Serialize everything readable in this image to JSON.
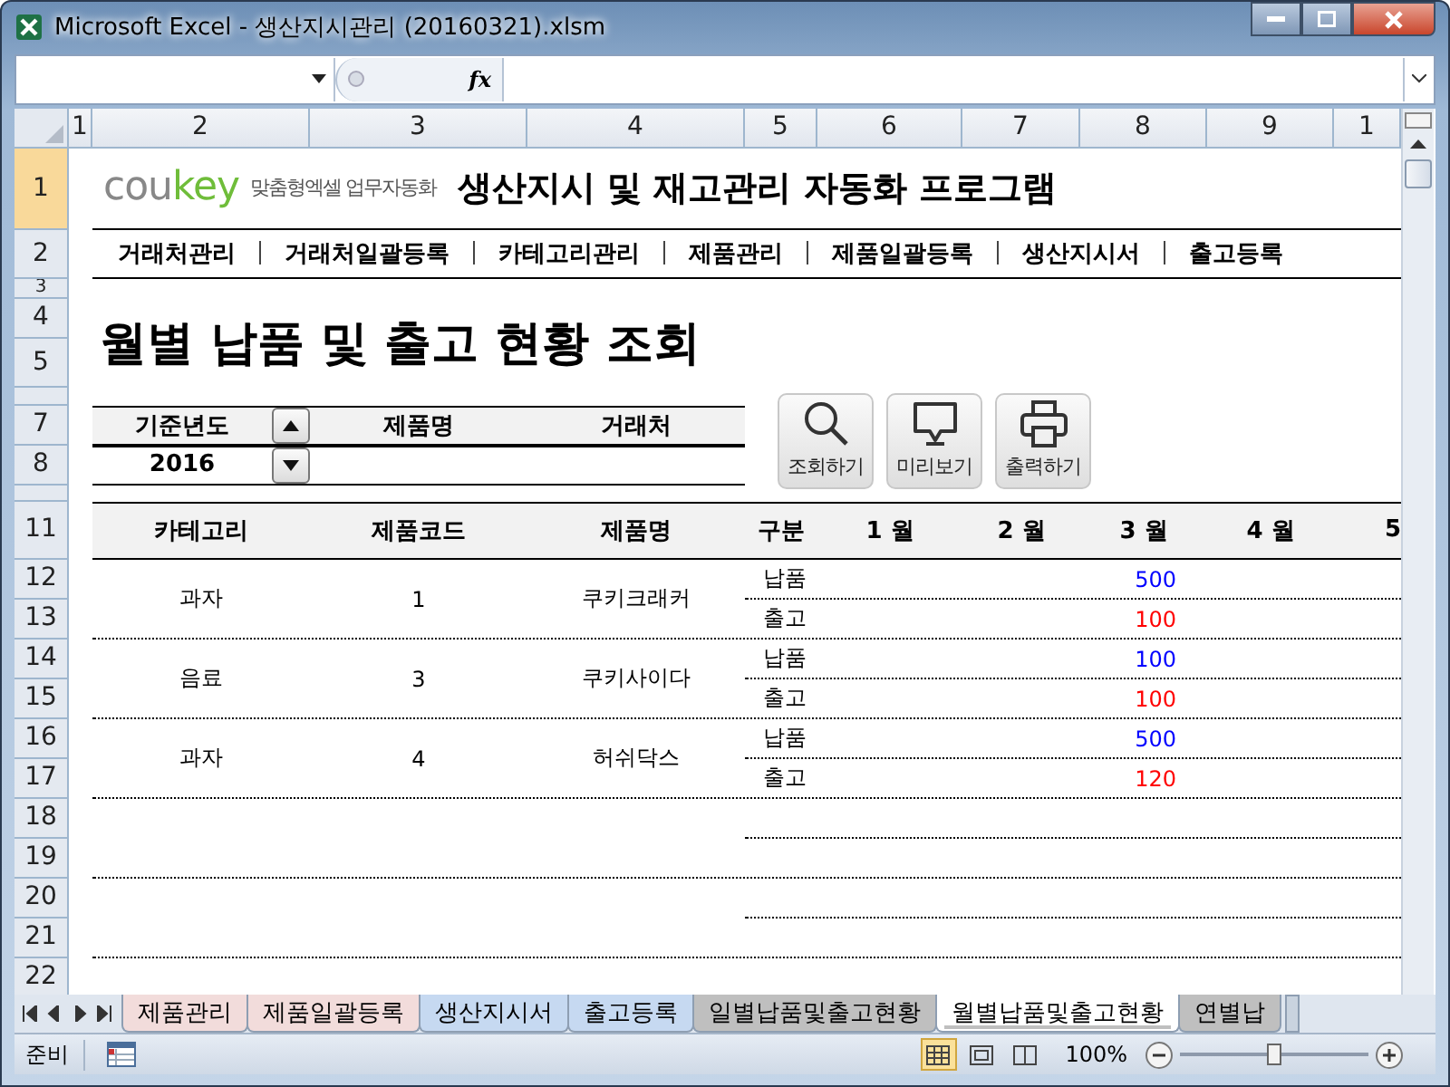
{
  "window": {
    "title": "Microsoft Excel - 생산지시관리 (20160321).xlsm"
  },
  "formula_bar": {
    "function_label": "fx"
  },
  "column_headers": [
    "1",
    "2",
    "3",
    "4",
    "5",
    "6",
    "7",
    "8",
    "9",
    "1"
  ],
  "row_headers": [
    "1",
    "2",
    "3",
    "4",
    "5",
    "7",
    "8",
    "11",
    "12",
    "13",
    "14",
    "15",
    "16",
    "17",
    "18",
    "19",
    "20",
    "21",
    "22"
  ],
  "brand": {
    "logo_start": "cou",
    "logo_end": "key",
    "tagline": "맞춤형엑셀 업무자동화",
    "title": "생산지시 및 재고관리 자동화 프로그램"
  },
  "nav": [
    "거래처관리",
    "거래처일괄등록",
    "카테고리관리",
    "제품관리",
    "제품일괄등록",
    "생산지시서",
    "출고등록"
  ],
  "page_title": "월별 납품 및 출고 현황 조회",
  "filters": {
    "year_label": "기준년도",
    "year": "2016",
    "product_label": "제품명",
    "client_label": "거래처"
  },
  "actions": [
    {
      "kind": "search",
      "label": "조회하기"
    },
    {
      "kind": "preview",
      "label": "미리보기"
    },
    {
      "kind": "print",
      "label": "출력하기"
    }
  ],
  "table": {
    "columns": [
      "카테고리",
      "제품코드",
      "제품명",
      "구분",
      "1 월",
      "2 월",
      "3 월",
      "4 월",
      "5"
    ],
    "rows": [
      {
        "category": "과자",
        "code": "1",
        "name": "쿠키크래커",
        "lines": [
          {
            "kind": "delivery",
            "label": "납품",
            "month_3": "500"
          },
          {
            "kind": "shipment",
            "label": "출고",
            "month_3": "100"
          }
        ]
      },
      {
        "category": "음료",
        "code": "3",
        "name": "쿠키사이다",
        "lines": [
          {
            "kind": "delivery",
            "label": "납품",
            "month_3": "100"
          },
          {
            "kind": "shipment",
            "label": "출고",
            "month_3": "100"
          }
        ]
      },
      {
        "category": "과자",
        "code": "4",
        "name": "허쉬닥스",
        "lines": [
          {
            "kind": "delivery",
            "label": "납품",
            "month_3": "500"
          },
          {
            "kind": "shipment",
            "label": "출고",
            "month_3": "120"
          }
        ]
      }
    ]
  },
  "sheet_tabs": [
    {
      "label": "제품관리",
      "color": "#f2dcdb",
      "selected": false
    },
    {
      "label": "제품일괄등록",
      "color": "#f2dcdb",
      "selected": false
    },
    {
      "label": "생산지시서",
      "color": "#c6d9f1",
      "selected": false
    },
    {
      "label": "출고등록",
      "color": "#c6d9f1",
      "selected": false
    },
    {
      "label": "일별납품및출고현황",
      "color": "#bfbfbf",
      "selected": false
    },
    {
      "label": "월별납품및출고현황",
      "color": "#bfbfbf",
      "selected": true
    },
    {
      "label": "연별납",
      "color": "#bfbfbf",
      "selected": false
    }
  ],
  "status_bar": {
    "mode": "준비",
    "views": [
      {
        "kind": "normal",
        "selected": true
      },
      {
        "kind": "page_layout",
        "selected": false
      },
      {
        "kind": "page_break",
        "selected": false
      }
    ],
    "zoom": "100%",
    "zoom_slider": {
      "level": 0.5
    }
  }
}
